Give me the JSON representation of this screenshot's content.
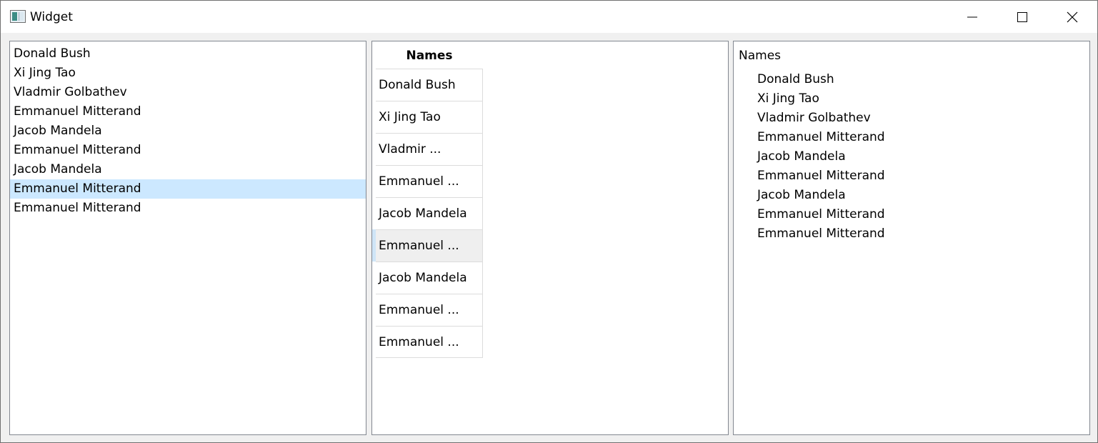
{
  "window": {
    "title": "Widget",
    "icon": "app-window-icon",
    "controls": [
      "minimize-icon",
      "maximize-icon",
      "close-icon"
    ]
  },
  "left_list": {
    "items": [
      "Donald Bush",
      "Xi Jing Tao",
      "Vladmir Golbathev",
      "Emmanuel Mitterand",
      "Jacob Mandela",
      "Emmanuel Mitterand",
      "Jacob Mandela",
      "Emmanuel Mitterand",
      "Emmanuel Mitterand"
    ],
    "selected_index": 7,
    "selection_color": "#cce8ff"
  },
  "middle_table": {
    "header": "Names",
    "cells": [
      "Donald Bush",
      "Xi Jing Tao",
      "Vladmir ...",
      "Emmanuel ...",
      "Jacob Mandela",
      "Emmanuel ...",
      "Jacob Mandela",
      "Emmanuel ...",
      "Emmanuel ..."
    ],
    "current_row_index": 5
  },
  "right_tree": {
    "root": "Names",
    "children": [
      "Donald Bush",
      "Xi Jing Tao",
      "Vladmir Golbathev",
      "Emmanuel Mitterand",
      "Jacob Mandela",
      "Emmanuel Mitterand",
      "Jacob Mandela",
      "Emmanuel Mitterand",
      "Emmanuel Mitterand"
    ]
  }
}
